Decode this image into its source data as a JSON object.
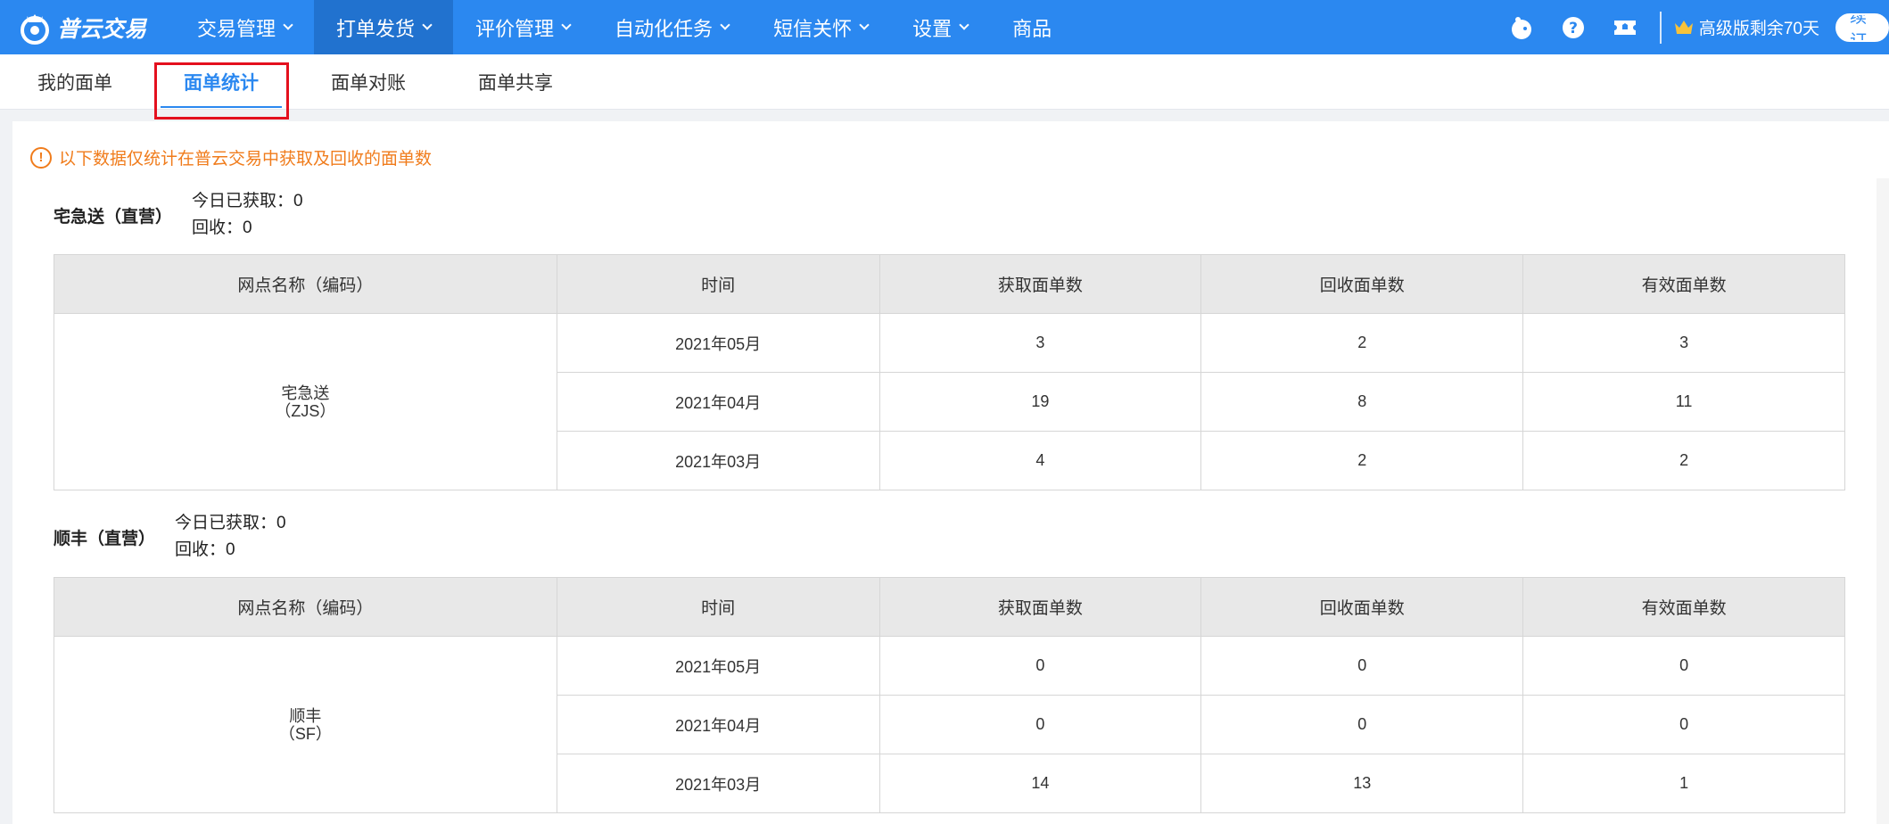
{
  "app": {
    "logo_text": "普云交易"
  },
  "nav": {
    "items": [
      {
        "label": "交易管理",
        "has_chevron": true
      },
      {
        "label": "打单发货",
        "has_chevron": true,
        "active": true
      },
      {
        "label": "评价管理",
        "has_chevron": true
      },
      {
        "label": "自动化任务",
        "has_chevron": true
      },
      {
        "label": "短信关怀",
        "has_chevron": true
      },
      {
        "label": "设置",
        "has_chevron": true
      },
      {
        "label": "商品",
        "has_chevron": false
      }
    ]
  },
  "top_right": {
    "icons": [
      "mascot-icon",
      "help-icon",
      "ticket-icon"
    ],
    "vip_label": "高级版剩余70天",
    "renew_label": "续订"
  },
  "subtabs": [
    {
      "label": "我的面单"
    },
    {
      "label": "面单统计",
      "active": true
    },
    {
      "label": "面单对账"
    },
    {
      "label": "面单共享"
    }
  ],
  "notice": {
    "text": "以下数据仅统计在普云交易中获取及回收的面单数",
    "icon": "warning-circle-icon"
  },
  "table_headers": [
    "网点名称（编码）",
    "时间",
    "获取面单数",
    "回收面单数",
    "有效面单数"
  ],
  "sections": [
    {
      "carrier": "宅急送（直营）",
      "today_fetched": "今日已获取：0",
      "recycled": "回收：0",
      "site_name": "宅急送",
      "site_code": "（ZJS）",
      "rows": [
        {
          "month": "2021年05月",
          "fetched": "3",
          "recycled": "2",
          "valid": "3"
        },
        {
          "month": "2021年04月",
          "fetched": "19",
          "recycled": "8",
          "valid": "11"
        },
        {
          "month": "2021年03月",
          "fetched": "4",
          "recycled": "2",
          "valid": "2"
        }
      ]
    },
    {
      "carrier": "顺丰（直营）",
      "today_fetched": "今日已获取：0",
      "recycled": "回收：0",
      "site_name": "顺丰",
      "site_code": "（SF）",
      "rows": [
        {
          "month": "2021年05月",
          "fetched": "0",
          "recycled": "0",
          "valid": "0"
        },
        {
          "month": "2021年04月",
          "fetched": "0",
          "recycled": "0",
          "valid": "0"
        },
        {
          "month": "2021年03月",
          "fetched": "14",
          "recycled": "13",
          "valid": "1"
        }
      ]
    }
  ],
  "colors": {
    "topbar": "#2b88f0",
    "active_nav": "#2172cf",
    "notice": "#f07c1c",
    "highlight": "#e4101e"
  }
}
